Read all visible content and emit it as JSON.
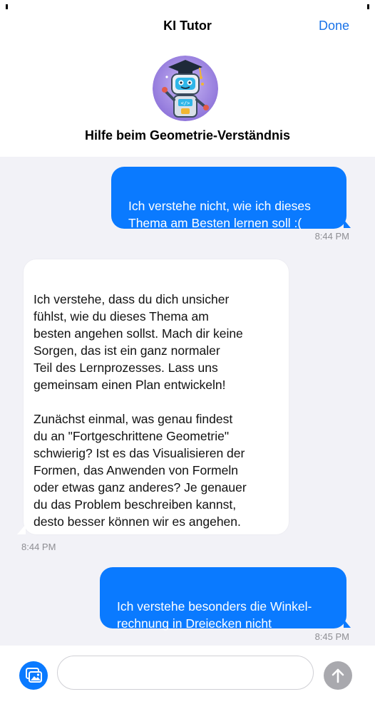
{
  "header": {
    "title": "KI Tutor",
    "done_label": "Done",
    "subtitle": "Hilfe beim Geometrie-Verständnis",
    "avatar_icon": "robot-tutor-icon"
  },
  "messages": [
    {
      "sender": "user",
      "text": "Ich verstehe nicht, wie ich dieses\nThema am Besten lernen soll :(",
      "time": "8:44 PM"
    },
    {
      "sender": "tutor",
      "text": "Ich verstehe, dass du dich unsicher\nfühlst, wie du dieses Thema am\nbesten angehen sollst. Mach dir keine\nSorgen, das ist ein ganz normaler\nTeil des Lernprozesses. Lass uns\ngemeinsam einen Plan entwickeln!\n\nZunächst einmal, was genau findest\ndu an \"Fortgeschrittene Geometrie\"\nschwierig? Ist es das Visualisieren der\nFormen, das Anwenden von Formeln\noder etwas ganz anderes? Je genauer\ndu das Problem beschreiben kannst,\ndesto besser können wir es angehen.",
      "time": "8:44 PM"
    },
    {
      "sender": "user",
      "text": "Ich verstehe besonders die Winkel-\nrechnung in Dreiecken nicht",
      "time": "8:45 PM"
    }
  ],
  "composer": {
    "placeholder": "",
    "photo_icon": "photo-library-icon",
    "send_icon": "arrow-up-icon"
  },
  "colors": {
    "accent": "#0a7aff",
    "chat_background": "#f2f2f7",
    "send_disabled": "#a9a9ae"
  }
}
